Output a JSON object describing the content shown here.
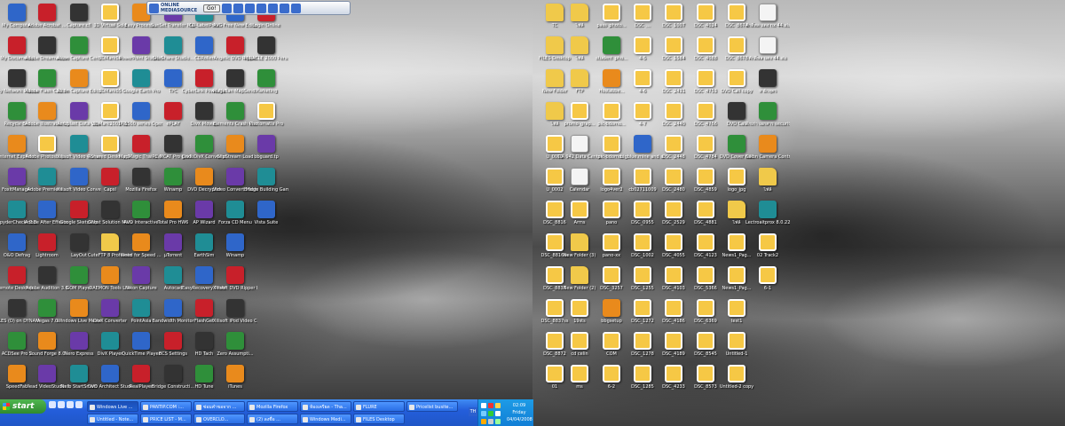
{
  "toolbar": {
    "logo": "ONLINE MEDIASOURCE",
    "go_label": "Go!"
  },
  "left_icons": [
    [
      "My Computer",
      "Adobe Acrobat ...",
      "Capture.cfl",
      "3D Virtual Solo",
      "Easy Process...",
      "SunSet Transfer Mate",
      "CD-LabelPrint",
      "AVG Free New Editor",
      "Login Online"
    ],
    [
      "My Documents",
      "Adobe Dreamweaver...",
      "Alcon Capture Central",
      "3DMark06",
      "PowerPoint Studio 4",
      "SiteShare Studio...",
      "CDRoller",
      "Angelic DVD Ripper",
      "MIRACLE 2000 Personal Beta"
    ],
    [
      "My Network Places",
      "Adobe Flash CS3 Prof...",
      "Alcon Capture Editor",
      "3DMark05",
      "Google Earth Pro",
      "TPC",
      "CyberLink PowerDVD",
      "Magellan MapSend DirectRoute",
      "Marketing"
    ],
    [
      "Recycle Bin",
      "Adobe Illustrator CS3",
      "Aeroplast Data Viewer",
      "3DMark2001 SE",
      "IP-5500 series Operation...",
      "ePLAY",
      "DivX Movies",
      "Elements Crash Center",
      "Photomatix Pro"
    ],
    [
      "Internet Explorer",
      "Adobe Photoshop...",
      "Xilisoft Video Converter 3",
      "4Shared Desktop 2007",
      "MapMagic Thailand...",
      "PC MCAT Pro guide",
      "DivX DivX Converter",
      "SlipStream Load",
      "bbguard.tp"
    ],
    [
      "FoxitManager",
      "Adobe Premiere...",
      "Xilisoft Video Converter",
      "Capsl",
      "Mozilla Firefox",
      "Winamp",
      "DVD Decrypter",
      "Video Convert Master",
      "Bridge Building Game"
    ],
    [
      "SpyderCheckr 2.2",
      "Adobe After Effects CS3",
      "Google SketchUp",
      "Ghost Solution Manager",
      "AVD Interactive",
      "Total Pro HW6",
      "AP Wizard",
      "Forza CD Menu",
      "Vista Suite"
    ],
    [
      "O&O Defrag",
      "Lightroom",
      "LayOut",
      "CuteFTP 8 Professional",
      "Need for Speed ...",
      "μTorrent",
      "EarthSim",
      "Winamp",
      ""
    ],
    [
      "Remote Desktop...",
      "Adobe Audition 3.0",
      "GOM Player",
      "DAEMON Tools Lite",
      "Nikon Capture",
      "Autocad",
      "EasyRecovery Professional",
      "Xilisoft DVD Ripper Pl...",
      ""
    ],
    [
      "FILES (D) on DYNAMIC...",
      "Vegas 7.0",
      "Windows Live Messenger",
      "DivX Converter",
      "PointAsia",
      "Bandwidth Monitor",
      "FlashGet",
      "Xilisoft iPod Video Co...",
      ""
    ],
    [
      "ACDSee Pro 2",
      "Sound Forge 8.0",
      "Nero Express",
      "DivX Player",
      "QuickTime Player",
      "BCS Settings",
      "HD Tach",
      "Zero Assumpti...",
      ""
    ],
    [
      "SpeedFan",
      "Ulead VideoStudio 10",
      "Nero StartSmart",
      "DVD Architect Studio 4.5",
      "RealPlayer",
      "Bridge Constructi...",
      "HD Tune",
      "iTunes",
      ""
    ]
  ],
  "right_icons": [
    [
      "TC",
      "ไฟล์",
      "pass_photo...",
      "DSC_...",
      "DSC_1007",
      "DSC_4024",
      "DSC_8674",
      "ศักดิ์พล แดง nx 44.xls"
    ],
    [
      "FILES Desktop",
      "ไฟล์",
      "student_pho...",
      "4-5",
      "DSC_1584",
      "DSC_4088",
      "DSC_8678",
      "ศักดิ์พล แดง 44.xls"
    ],
    [
      "New Folder",
      "FTP",
      "Hostabbe...",
      "4-6",
      "DSC_2431",
      "DSC_4753",
      "DVD Call copy",
      "ห ลักสูตร"
    ],
    [
      "ไฟล์",
      "promo_grap...",
      "pic-bdomo...",
      "4-7",
      "DSC_2440",
      "DSC_4766",
      "DVD Call",
      "ดักเก่า เอกสาร security.xl..."
    ],
    [
      "U_0001",
      "TIA 942 Data Center",
      "pic-bdomo...",
      "bigblue.mine and adbeni.",
      "DSC_2448",
      "DSC_4784",
      "DVD Cover Call",
      "Nikon Camera Control Pro"
    ],
    [
      "U_0002",
      "Calendar",
      "logo4ver2",
      "cb02711009",
      "DSC_2480",
      "DSC_4859",
      "logo_jpg",
      "ไฟล์"
    ],
    [
      "DSC_8816",
      "Arms",
      "pano",
      "DSC_0955",
      "DSC_2529",
      "DSC_4881",
      "ไฟล์",
      "Lectroaitprox 8.0.227"
    ],
    [
      "DSC_8816ss",
      "New Folder (3)",
      "pano-xx",
      "DSC_1002",
      "DSC_4055",
      "DSC_4123",
      "News1_Pag...",
      "02 Track2"
    ],
    [
      "DSC_8837",
      "New Folder (2)",
      "DSC_3257",
      "DSC_1255",
      "DSC_4103",
      "DSC_5366",
      "News1_Pag...",
      "6-1"
    ],
    [
      "DSC_8837ss",
      "19sts",
      "bbgsetup",
      "DSC_1272",
      "DSC_4186",
      "DSC_6369",
      "test1",
      ""
    ],
    [
      "DSC_8872",
      "cd celin",
      "COM",
      "DSC_1278",
      "DSC_4189",
      "DSC_8545",
      "Untitled-1",
      ""
    ],
    [
      "01",
      "ms",
      "6-2",
      "DSC_1285",
      "DSC_4233",
      "DSC_8573",
      "Untitled-2 copy",
      ""
    ]
  ],
  "taskbar": {
    "start_label": "start",
    "row1": [
      "Windows Live ...",
      "PANTIP.COM :...",
      "ซ่อมคำขอจาก ...",
      "Mozilla Firefox",
      "ห้องเครียด - Tha...",
      "FLURE",
      "Pricelist busite..."
    ],
    "row2": [
      "Untitled - Note...",
      "PRICE LIST - M...",
      "OVERCLO...",
      "(2) ลงชื่อ ...",
      "Windows Medi...",
      "FILES Desktop"
    ],
    "lang": "TH",
    "clock": {
      "time": "02:09",
      "day": "Friday",
      "date": "04/04/2008"
    }
  }
}
